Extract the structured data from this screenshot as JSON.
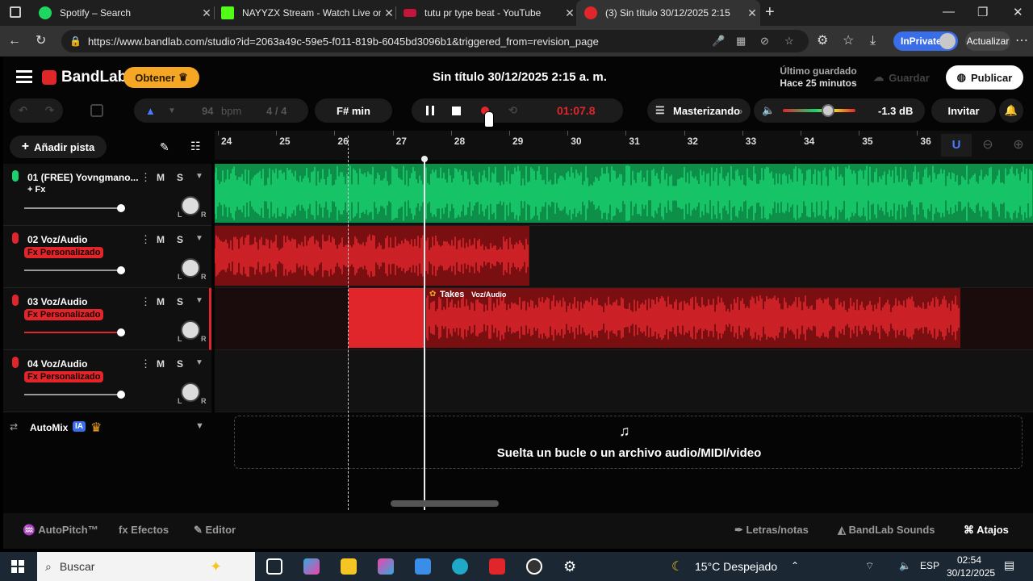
{
  "browser": {
    "tabs": [
      {
        "title": "Spotify – Search",
        "fav_color": "#1ed760"
      },
      {
        "title": "NAYYZX Stream - Watch Live on K",
        "fav_color": "#53fc18"
      },
      {
        "title": "tutu pr type beat - YouTube",
        "fav_color": "#ff0033"
      },
      {
        "title": "(3) Sin título 30/12/2025 2:15",
        "fav_color": "#e0262b"
      }
    ],
    "url": "https://www.bandlab.com/studio?id=2063a49c-59e5-f011-819b-6045bd3096b1&triggered_from=revision_page",
    "inprivate_label": "InPrivate",
    "update_label": "Actualizar"
  },
  "header": {
    "logo_text": "BandLab",
    "obtener_label": "Obtener",
    "project_title": "Sin título 30/12/2025 2:15 a. m.",
    "last_saved_label": "Último guardado",
    "last_saved_time": "Hace 25 minutos",
    "guardar_label": "Guardar",
    "publicar_label": "Publicar"
  },
  "transport": {
    "bpm_value": "94",
    "bpm_label": "bpm",
    "time_signature": "4 / 4",
    "key": "F# min",
    "time": "01:07.8",
    "mastering_label": "Masterizando",
    "db_value": "-1.3 dB",
    "volume_level": 0.62,
    "invitar_label": "Invitar"
  },
  "timeline": {
    "add_track_label": "Añadir pista",
    "bars": [
      "24",
      "25",
      "26",
      "27",
      "28",
      "29",
      "30",
      "31",
      "32",
      "33",
      "34",
      "35",
      "36"
    ]
  },
  "tracks": [
    {
      "name": "01  (FREE) Yovngmano...",
      "fx": "+ Fx",
      "color": "#19d26f",
      "mute": "M",
      "solo": "S",
      "vol": 0.99
    },
    {
      "name": "02  Voz/Audio",
      "fx": "Fx Personalizado",
      "color": "#e0262b",
      "mute": "M",
      "solo": "S",
      "vol": 0.99
    },
    {
      "name": "03  Voz/Audio",
      "fx": "Fx Personalizado",
      "color": "#e0262b",
      "mute": "M",
      "solo": "S",
      "vol": 0.99
    },
    {
      "name": "04  Voz/Audio",
      "fx": "Fx Personalizado",
      "color": "#e0262b",
      "mute": "M",
      "solo": "S",
      "vol": 0.99
    }
  ],
  "takes_label": "Takes",
  "takes_sub": "Voz/Audio",
  "automix": {
    "label": "AutoMix",
    "badge": "IA"
  },
  "drop_zone_text": "Suelta un bucle o un archivo audio/MIDI/video",
  "bottom": {
    "autopitch": "AutoPitch™",
    "efectos": "Efectos",
    "editor": "Editor",
    "letras": "Letras/notas",
    "sounds": "BandLab Sounds",
    "atajos": "Atajos"
  },
  "taskbar": {
    "search_placeholder": "Buscar",
    "weather": "15°C  Despejado",
    "lang": "ESP",
    "time": "02:54",
    "date": "30/12/2025"
  },
  "colors": {
    "green": "#19d26f",
    "red": "#e0262b",
    "accent_orange": "#f5a623"
  }
}
